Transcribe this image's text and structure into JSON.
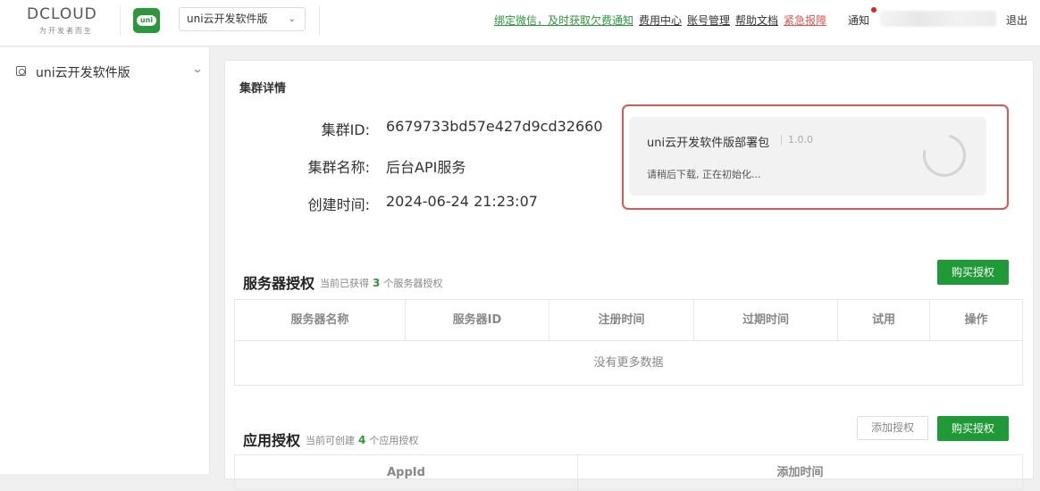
{
  "header": {
    "logo_text": "DCLOUD",
    "logo_subtitle": "为开发者而生",
    "uni_logo_text": "uni",
    "app_select_value": "uni云开发软件版",
    "links": [
      {
        "label": "绑定微信，及时获取欠费通知",
        "style": "green"
      },
      {
        "label": "费用中心",
        "style": "normal"
      },
      {
        "label": "账号管理",
        "style": "normal"
      },
      {
        "label": "帮助文档",
        "style": "normal"
      },
      {
        "label": "紧急报障",
        "style": "red"
      }
    ],
    "notice_label": "通知",
    "logout_label": "退出"
  },
  "sidebar": {
    "items": [
      {
        "label": "uni云开发软件版"
      }
    ]
  },
  "cluster": {
    "section_title": "集群详情",
    "id_label": "集群ID:",
    "id_value": "6679733bd57e427d9cd32660",
    "name_label": "集群名称:",
    "name_value": "后台API服务",
    "created_label": "创建时间:",
    "created_value": "2024-06-24 21:23:07"
  },
  "package_card": {
    "title": "uni云开发软件版部署包",
    "version": "1.0.0",
    "status": "请稍后下载, 正在初始化..."
  },
  "server_auth": {
    "title": "服务器授权",
    "sub_prefix": "当前已获得",
    "count": "3",
    "sub_suffix": "个服务器授权",
    "buy_label": "购买授权",
    "columns": [
      "服务器名称",
      "服务器ID",
      "注册时间",
      "过期时间",
      "试用",
      "操作"
    ],
    "empty_text": "没有更多数据"
  },
  "app_auth": {
    "title": "应用授权",
    "sub_prefix": "当前可创建",
    "count": "4",
    "sub_suffix": "个应用授权",
    "add_label": "添加授权",
    "buy_label": "购买授权",
    "columns": [
      "AppId",
      "添加时间"
    ]
  },
  "colors": {
    "accent_green": "#1f9a36",
    "alert_red": "#e0554f"
  }
}
